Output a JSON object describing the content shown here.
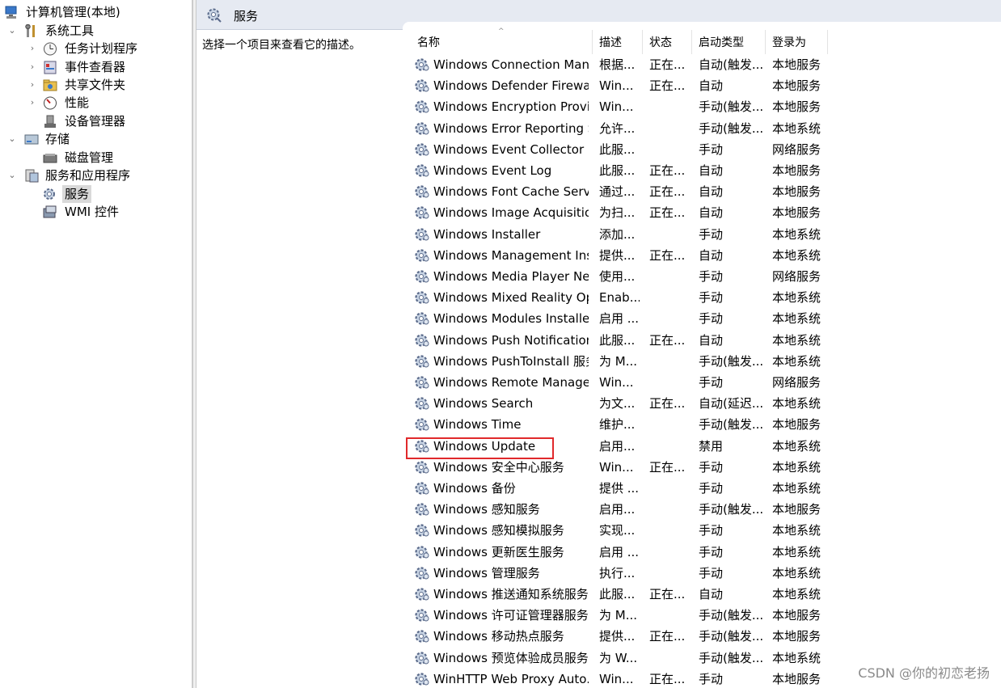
{
  "tree": {
    "root": "计算机管理(本地)",
    "system_tools": "系统工具",
    "task_scheduler": "任务计划程序",
    "event_viewer": "事件查看器",
    "shared_folders": "共享文件夹",
    "performance": "性能",
    "device_manager": "设备管理器",
    "storage": "存储",
    "disk_management": "磁盘管理",
    "services_apps": "服务和应用程序",
    "services": "服务",
    "wmi": "WMI 控件"
  },
  "header": {
    "title": "服务"
  },
  "description": "选择一个项目来查看它的描述。",
  "columns": {
    "name": "名称",
    "desc": "描述",
    "status": "状态",
    "startup": "启动类型",
    "logon": "登录为"
  },
  "services": [
    {
      "name": "Windows Connection Man...",
      "desc": "根据...",
      "status": "正在...",
      "startup": "自动(触发...",
      "logon": "本地服务"
    },
    {
      "name": "Windows Defender Firewall",
      "desc": "Win...",
      "status": "正在...",
      "startup": "自动",
      "logon": "本地服务"
    },
    {
      "name": "Windows Encryption Provid...",
      "desc": "Win...",
      "status": "",
      "startup": "手动(触发...",
      "logon": "本地服务"
    },
    {
      "name": "Windows Error Reporting S...",
      "desc": "允许...",
      "status": "",
      "startup": "手动(触发...",
      "logon": "本地系统"
    },
    {
      "name": "Windows Event Collector",
      "desc": "此服...",
      "status": "",
      "startup": "手动",
      "logon": "网络服务"
    },
    {
      "name": "Windows Event Log",
      "desc": "此服...",
      "status": "正在...",
      "startup": "自动",
      "logon": "本地服务"
    },
    {
      "name": "Windows Font Cache Servi...",
      "desc": "通过...",
      "status": "正在...",
      "startup": "自动",
      "logon": "本地服务"
    },
    {
      "name": "Windows Image Acquisitio...",
      "desc": "为扫...",
      "status": "正在...",
      "startup": "自动",
      "logon": "本地服务"
    },
    {
      "name": "Windows Installer",
      "desc": "添加...",
      "status": "",
      "startup": "手动",
      "logon": "本地系统"
    },
    {
      "name": "Windows Management Ins...",
      "desc": "提供...",
      "status": "正在...",
      "startup": "自动",
      "logon": "本地系统"
    },
    {
      "name": "Windows Media Player Net...",
      "desc": "使用...",
      "status": "",
      "startup": "手动",
      "logon": "网络服务"
    },
    {
      "name": "Windows Mixed Reality Op...",
      "desc": "Enab...",
      "status": "",
      "startup": "手动",
      "logon": "本地系统"
    },
    {
      "name": "Windows Modules Installer",
      "desc": "启用 ...",
      "status": "",
      "startup": "手动",
      "logon": "本地系统"
    },
    {
      "name": "Windows Push Notification...",
      "desc": "此服...",
      "status": "正在...",
      "startup": "自动",
      "logon": "本地系统"
    },
    {
      "name": "Windows PushToInstall 服务",
      "desc": "为 M...",
      "status": "",
      "startup": "手动(触发...",
      "logon": "本地系统"
    },
    {
      "name": "Windows Remote Manage...",
      "desc": "Win...",
      "status": "",
      "startup": "手动",
      "logon": "网络服务"
    },
    {
      "name": "Windows Search",
      "desc": "为文...",
      "status": "正在...",
      "startup": "自动(延迟...",
      "logon": "本地系统"
    },
    {
      "name": "Windows Time",
      "desc": "维护...",
      "status": "",
      "startup": "手动(触发...",
      "logon": "本地服务"
    },
    {
      "name": "Windows Update",
      "desc": "启用...",
      "status": "",
      "startup": "禁用",
      "logon": "本地系统"
    },
    {
      "name": "Windows 安全中心服务",
      "desc": "Win...",
      "status": "正在...",
      "startup": "手动",
      "logon": "本地系统"
    },
    {
      "name": "Windows 备份",
      "desc": "提供 ...",
      "status": "",
      "startup": "手动",
      "logon": "本地系统"
    },
    {
      "name": "Windows 感知服务",
      "desc": "启用...",
      "status": "",
      "startup": "手动(触发...",
      "logon": "本地服务"
    },
    {
      "name": "Windows 感知模拟服务",
      "desc": "实现...",
      "status": "",
      "startup": "手动",
      "logon": "本地系统"
    },
    {
      "name": "Windows 更新医生服务",
      "desc": "启用 ...",
      "status": "",
      "startup": "手动",
      "logon": "本地系统"
    },
    {
      "name": "Windows 管理服务",
      "desc": "执行...",
      "status": "",
      "startup": "手动",
      "logon": "本地系统"
    },
    {
      "name": "Windows 推送通知系统服务",
      "desc": "此服...",
      "status": "正在...",
      "startup": "自动",
      "logon": "本地系统"
    },
    {
      "name": "Windows 许可证管理器服务",
      "desc": "为 M...",
      "status": "",
      "startup": "手动(触发...",
      "logon": "本地服务"
    },
    {
      "name": "Windows 移动热点服务",
      "desc": "提供...",
      "status": "正在...",
      "startup": "手动(触发...",
      "logon": "本地服务"
    },
    {
      "name": "Windows 预览体验成员服务",
      "desc": "为 W...",
      "status": "",
      "startup": "手动(触发...",
      "logon": "本地系统"
    },
    {
      "name": "WinHTTP Web Proxy Auto...",
      "desc": "Win...",
      "status": "正在...",
      "startup": "手动",
      "logon": "本地服务"
    }
  ],
  "watermark": "CSDN @你的初恋老扬"
}
